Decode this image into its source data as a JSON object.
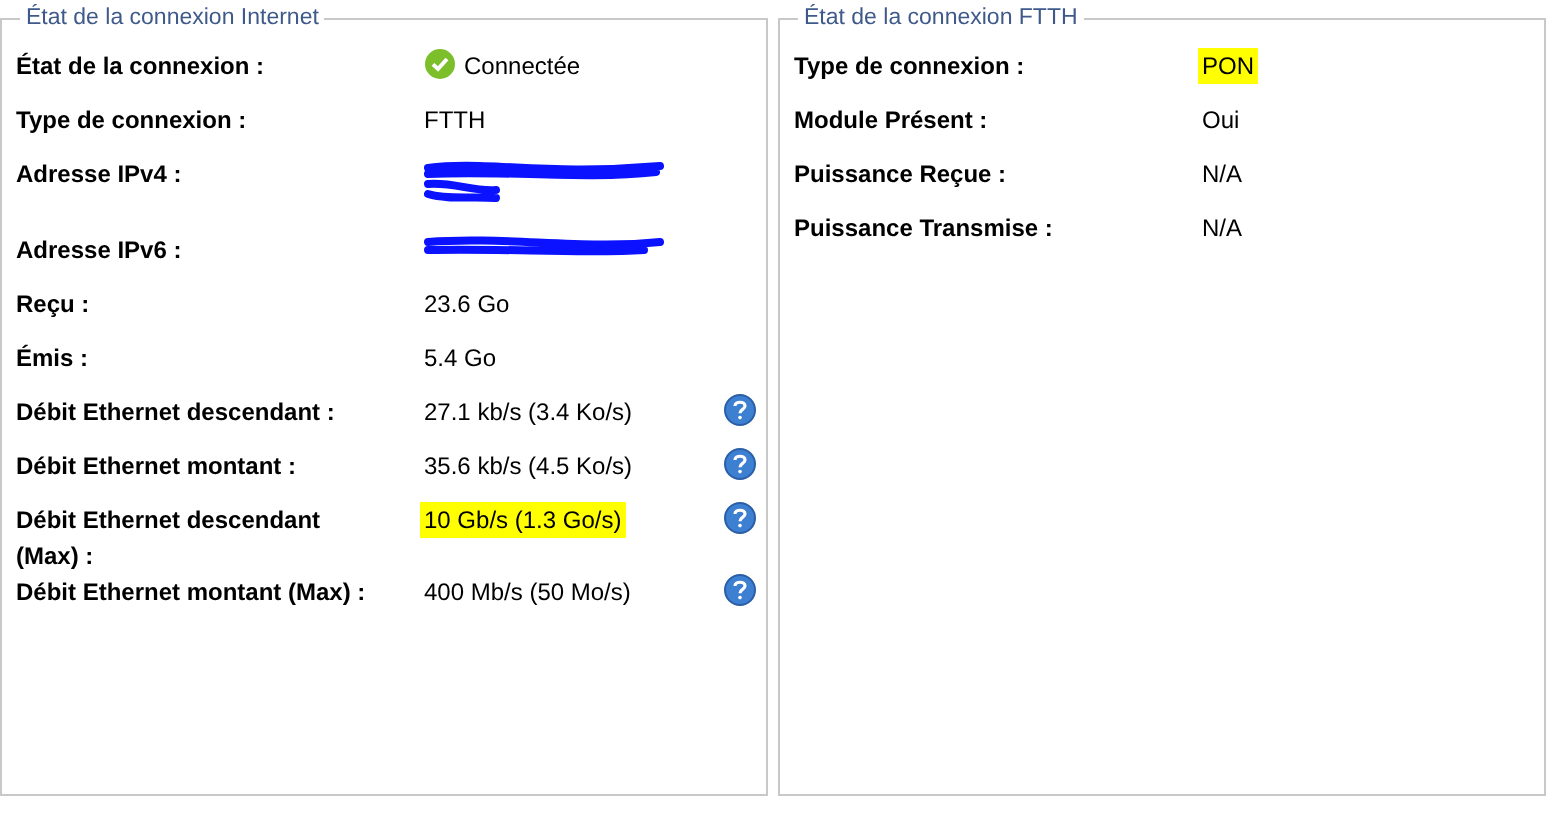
{
  "panels": [
    {
      "legend": "État de la connexion Internet",
      "rows": [
        {
          "label": "État de la connexion :",
          "value": "Connectée",
          "status_icon": true,
          "help": false,
          "highlighted": false
        },
        {
          "label": "Type de connexion :",
          "value": "FTTH",
          "help": false,
          "highlighted": false
        },
        {
          "label": "Adresse IPv4 :",
          "redacted": true,
          "tall": true,
          "help": false,
          "highlighted": false
        },
        {
          "label": "Adresse IPv6 :",
          "redacted": true,
          "help": false,
          "highlighted": false
        },
        {
          "label": "Reçu :",
          "value": "23.6 Go",
          "help": false,
          "highlighted": false
        },
        {
          "label": "Émis :",
          "value": "5.4 Go",
          "help": false,
          "highlighted": false
        },
        {
          "label": "Débit Ethernet descendant :",
          "value": "27.1 kb/s (3.4 Ko/s)",
          "help": true,
          "highlighted": false
        },
        {
          "label": "Débit Ethernet montant :",
          "value": "35.6 kb/s (4.5 Ko/s)",
          "help": true,
          "highlighted": false
        },
        {
          "label": "Débit Ethernet descendant (Max) :",
          "value": "10 Gb/s (1.3 Go/s)",
          "help": true,
          "highlighted": true
        },
        {
          "label": "Débit Ethernet montant (Max) :",
          "value": "400 Mb/s (50 Mo/s)",
          "help": true,
          "highlighted": false
        }
      ]
    },
    {
      "legend": "État de la connexion FTTH",
      "rows": [
        {
          "label": "Type de connexion :",
          "value": "PON",
          "help": false,
          "highlighted": true
        },
        {
          "label": "Module Présent :",
          "value": "Oui",
          "help": false,
          "highlighted": false
        },
        {
          "label": "Puissance Reçue :",
          "value": "N/A",
          "help": false,
          "highlighted": false
        },
        {
          "label": "Puissance Transmise :",
          "value": "N/A",
          "help": false,
          "highlighted": false
        }
      ]
    }
  ]
}
